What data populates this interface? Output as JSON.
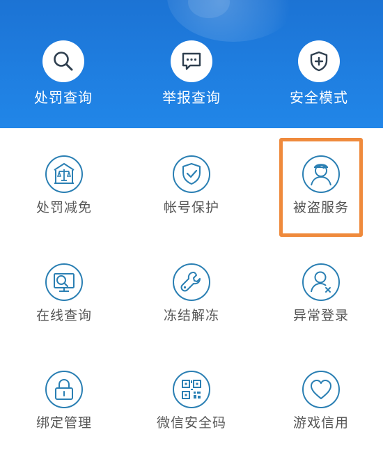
{
  "colors": {
    "header_blue": "#1f7ee0",
    "icon_stroke": "#2a7fb3",
    "label_gray": "#555555",
    "highlight_orange": "#ef8a3c"
  },
  "top_actions": [
    {
      "label": "处罚查询",
      "icon": "search-icon"
    },
    {
      "label": "举报查询",
      "icon": "chat-icon"
    },
    {
      "label": "安全模式",
      "icon": "shield-plus-icon"
    }
  ],
  "services": [
    {
      "label": "处罚减免",
      "icon": "scale-building-icon"
    },
    {
      "label": "帐号保护",
      "icon": "shield-check-icon"
    },
    {
      "label": "被盗服务",
      "icon": "thief-person-icon",
      "highlighted": true
    },
    {
      "label": "在线查询",
      "icon": "monitor-search-icon"
    },
    {
      "label": "冻结解冻",
      "icon": "wrench-icon"
    },
    {
      "label": "异常登录",
      "icon": "person-x-icon"
    },
    {
      "label": "绑定管理",
      "icon": "lock-icon"
    },
    {
      "label": "微信安全码",
      "icon": "qr-code-icon"
    },
    {
      "label": "游戏信用",
      "icon": "heart-icon"
    }
  ]
}
